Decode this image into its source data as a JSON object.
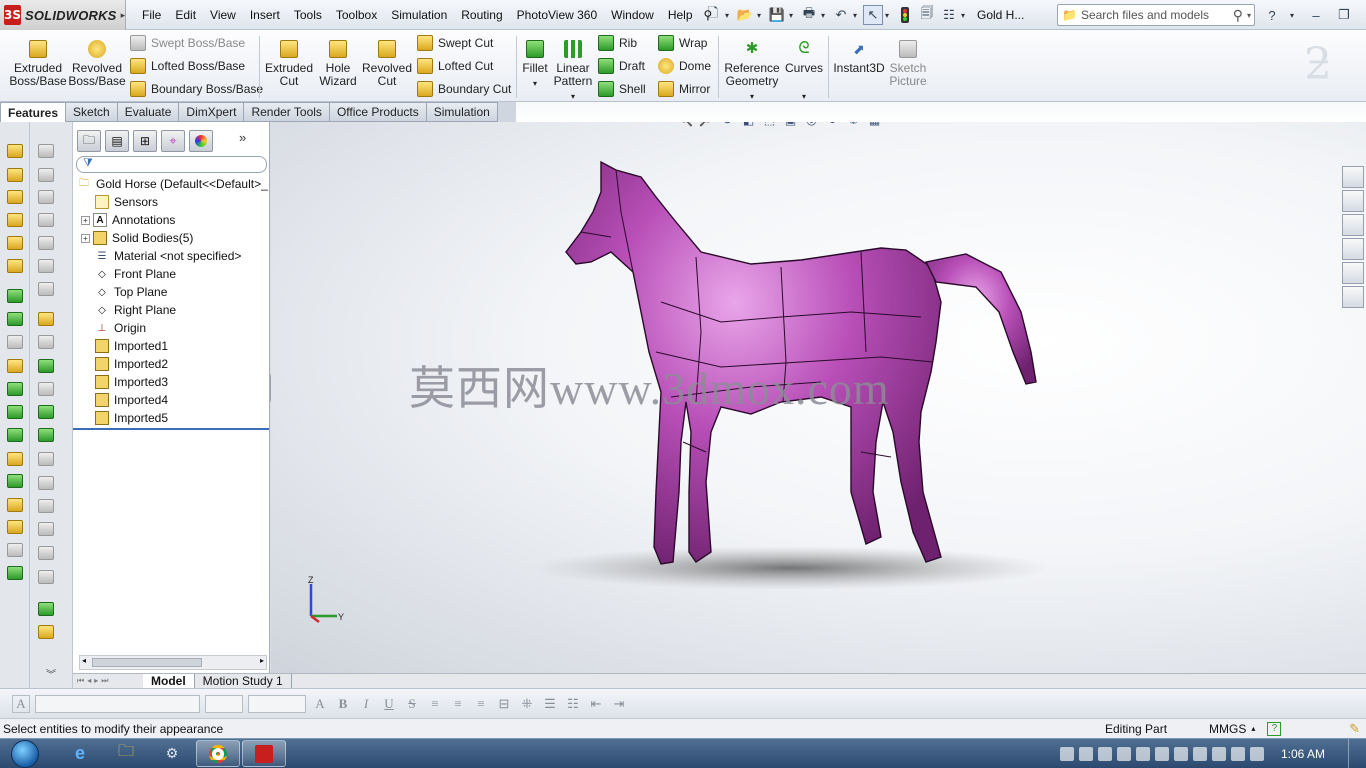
{
  "app": {
    "name": "SOLIDWORKS",
    "logo_letters": "3S"
  },
  "menu": [
    "File",
    "Edit",
    "View",
    "Insert",
    "Tools",
    "Toolbox",
    "Simulation",
    "Routing",
    "PhotoView 360",
    "Window",
    "Help"
  ],
  "doc_short_title": "Gold H...",
  "search": {
    "placeholder": "Search files and models"
  },
  "command_manager": {
    "extruded_boss": "Extruded Boss/Base",
    "revolved_boss": "Revolved Boss/Base",
    "swept_boss": "Swept Boss/Base",
    "lofted_boss": "Lofted Boss/Base",
    "boundary_boss": "Boundary Boss/Base",
    "extruded_cut": "Extruded Cut",
    "hole_wizard": "Hole Wizard",
    "revolved_cut": "Revolved Cut",
    "swept_cut": "Swept Cut",
    "lofted_cut": "Lofted Cut",
    "boundary_cut": "Boundary Cut",
    "fillet": "Fillet",
    "linear_pattern": "Linear Pattern",
    "rib": "Rib",
    "draft": "Draft",
    "shell": "Shell",
    "wrap": "Wrap",
    "dome": "Dome",
    "mirror": "Mirror",
    "reference_geometry": "Reference Geometry",
    "curves": "Curves",
    "instant3d": "Instant3D",
    "sketch_picture": "Sketch Picture"
  },
  "tabs": [
    "Features",
    "Sketch",
    "Evaluate",
    "DimXpert",
    "Render Tools",
    "Office Products",
    "Simulation"
  ],
  "tree": {
    "root": "Gold Horse  (Default<<Default>_",
    "items": [
      "Sensors",
      "Annotations",
      "Solid Bodies(5)",
      "Material <not specified>",
      "Front Plane",
      "Top Plane",
      "Right Plane",
      "Origin",
      "Imported1",
      "Imported2",
      "Imported3",
      "Imported4",
      "Imported5"
    ]
  },
  "watermark": "莫西网www.3dmox.com",
  "triad": {
    "z": "Z",
    "y": "Y"
  },
  "model_tabs": [
    "Model",
    "Motion Study 1"
  ],
  "format_bar": {
    "bold": "B",
    "italic": "I",
    "underline": "U",
    "strike": "S",
    "font_glyph": "A"
  },
  "status": {
    "message": "Select entities to modify their appearance",
    "mode": "Editing Part",
    "units": "MMGS"
  },
  "taskbar": {
    "time": "1:06 AM"
  },
  "colors": {
    "horse": "#b04cb0",
    "solidworks_red": "#c81e1e"
  }
}
